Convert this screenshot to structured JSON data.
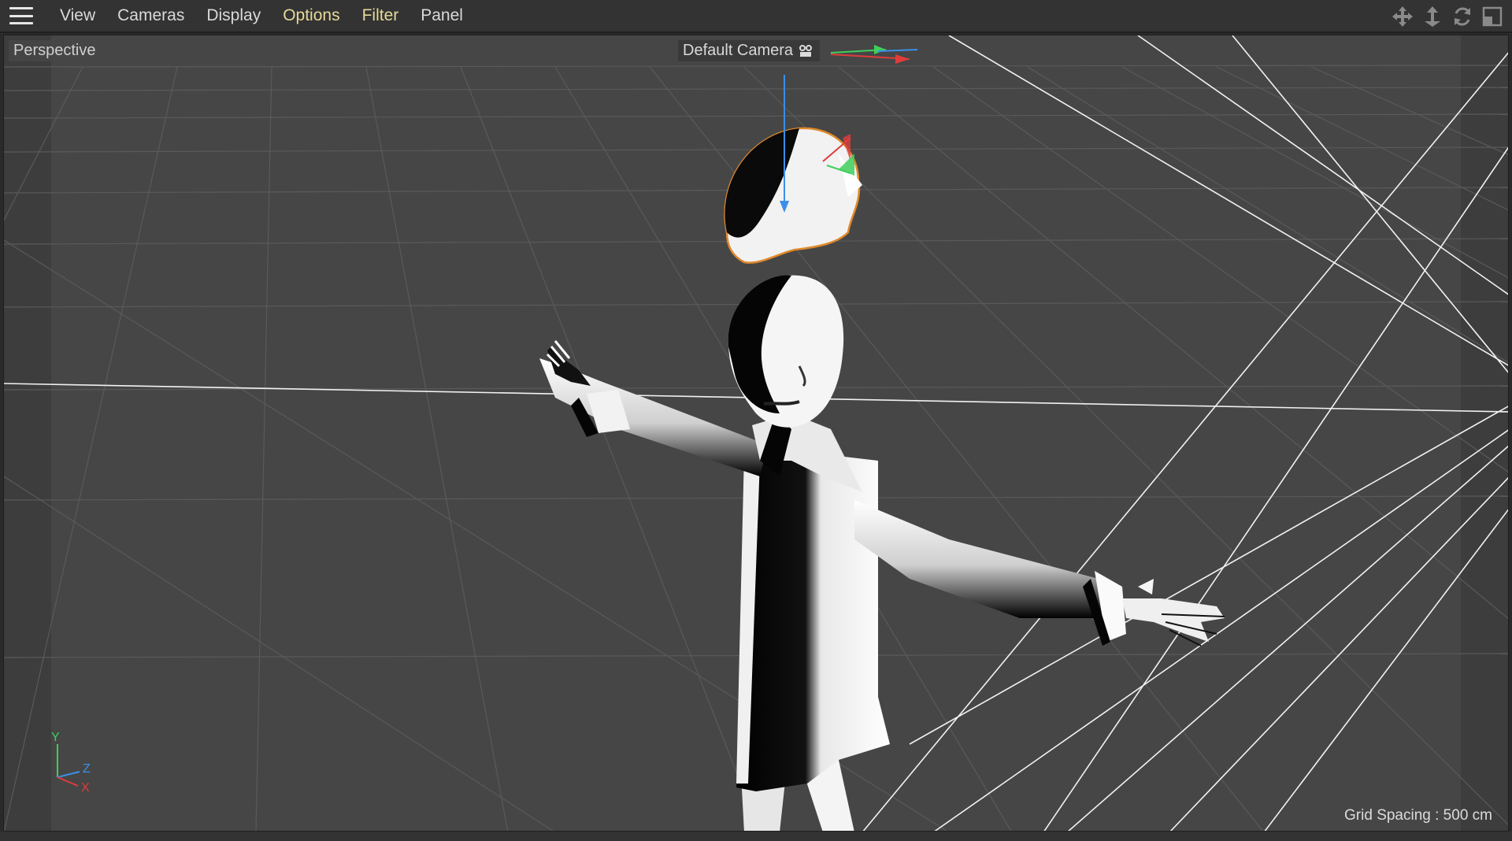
{
  "menu": {
    "items": [
      {
        "label": "View",
        "highlight": false
      },
      {
        "label": "Cameras",
        "highlight": false
      },
      {
        "label": "Display",
        "highlight": false
      },
      {
        "label": "Options",
        "highlight": true
      },
      {
        "label": "Filter",
        "highlight": true
      },
      {
        "label": "Panel",
        "highlight": false
      }
    ],
    "nav_icons": [
      "move-view-icon",
      "dolly-view-icon",
      "rotate-view-icon",
      "maximize-view-icon"
    ]
  },
  "viewport": {
    "projection_label": "Perspective",
    "camera_label": "Default Camera",
    "grid_spacing": "Grid Spacing : 500 cm",
    "axis": {
      "y": "Y",
      "z": "Z",
      "x": "X"
    }
  },
  "colors": {
    "highlight_menu": "#e7d99a",
    "viewport_bg": "#464646",
    "axis_x": "#e03c3c",
    "axis_y": "#3fcf5c",
    "axis_z": "#3a8fe8",
    "selection_outline": "#e0892c"
  }
}
